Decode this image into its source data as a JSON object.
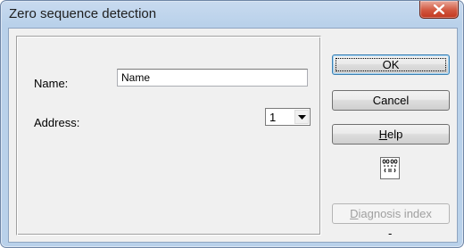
{
  "window": {
    "title": "Zero sequence detection",
    "close_icon": "close-x-icon"
  },
  "form": {
    "name_label": "Name:",
    "name_value": "Name",
    "address_label": "Address:",
    "address_value": "1"
  },
  "buttons": {
    "ok": "OK",
    "cancel": "Cancel",
    "help_prefix": "",
    "help_accel": "H",
    "help_rest": "elp",
    "diag_accel": "D",
    "diag_rest": "iagnosis index"
  },
  "status": {
    "dash": "-"
  },
  "icons": {
    "module_icon": "io-module-icon"
  }
}
